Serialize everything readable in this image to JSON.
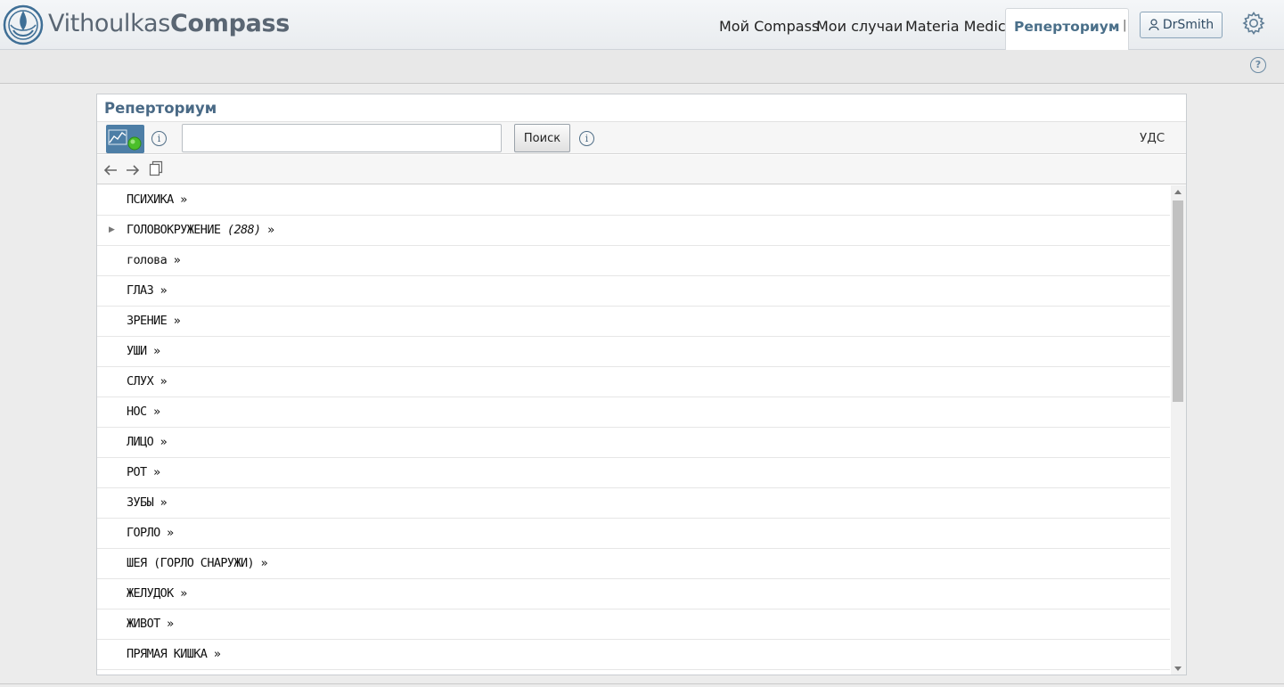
{
  "brand": {
    "part1": "Vithoulkas",
    "part2": "Compass"
  },
  "nav": {
    "items": [
      {
        "label": "Мой Compass"
      },
      {
        "label": "Мои случаи"
      },
      {
        "label": "Materia Medica"
      },
      {
        "label": "Реперториум"
      }
    ],
    "separator": "|",
    "user": "DrSmith"
  },
  "help": "?",
  "panel": {
    "title": "Реперториум",
    "info": "i",
    "search_value": "",
    "search_placeholder": "",
    "search_button": "Поиск",
    "uds": "УДС"
  },
  "list": {
    "raquo": "»",
    "rows": [
      {
        "label": "ПСИХИКА",
        "count": ""
      },
      {
        "label": "ГОЛОВОКРУЖЕНИЕ",
        "count": "(288)"
      },
      {
        "label": "голова",
        "count": ""
      },
      {
        "label": "ГЛАЗ",
        "count": ""
      },
      {
        "label": "ЗРЕНИЕ",
        "count": ""
      },
      {
        "label": "УШИ",
        "count": ""
      },
      {
        "label": "СЛУХ",
        "count": ""
      },
      {
        "label": "НОС",
        "count": ""
      },
      {
        "label": "ЛИЦО",
        "count": ""
      },
      {
        "label": "РОТ",
        "count": ""
      },
      {
        "label": "ЗУБЫ",
        "count": ""
      },
      {
        "label": "ГОРЛО",
        "count": ""
      },
      {
        "label": "ШЕЯ (ГОРЛО СНАРУЖИ)",
        "count": ""
      },
      {
        "label": "ЖЕЛУДОК",
        "count": ""
      },
      {
        "label": "ЖИВОТ",
        "count": ""
      },
      {
        "label": "ПРЯМАЯ КИШКА",
        "count": ""
      }
    ]
  },
  "colors": {
    "accent": "#4a6a86",
    "tab_active": "#4a6f89",
    "tool_bg": "#4d7ea6"
  }
}
